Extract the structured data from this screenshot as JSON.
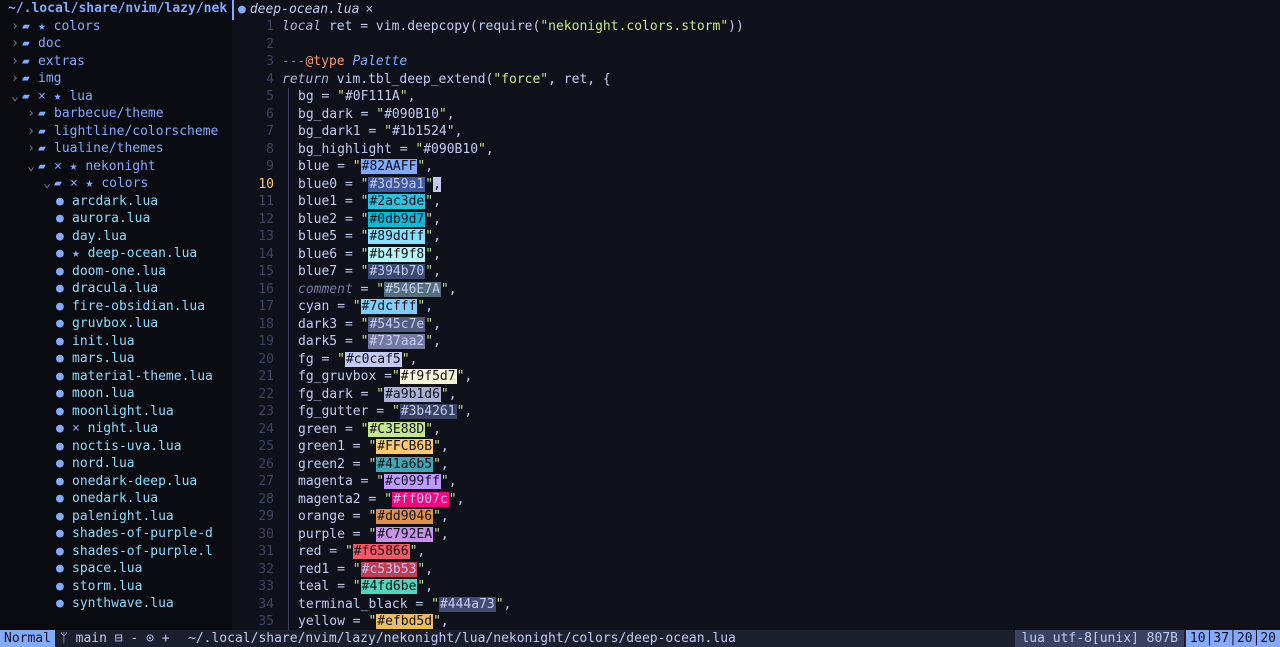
{
  "tree": {
    "root": "~/.local/share/nvim/lazy/nek",
    "rows": [
      {
        "indent": 0,
        "chev": "›",
        "type": "dir",
        "icon": "folder-icon",
        "marks": "★",
        "name": "colors"
      },
      {
        "indent": 0,
        "chev": "›",
        "type": "dir",
        "icon": "folder-icon",
        "marks": "",
        "name": "doc"
      },
      {
        "indent": 0,
        "chev": "›",
        "type": "dir",
        "icon": "folder-icon",
        "marks": "",
        "name": "extras"
      },
      {
        "indent": 0,
        "chev": "›",
        "type": "dir",
        "icon": "folder-icon",
        "marks": "",
        "name": "img"
      },
      {
        "indent": 0,
        "chev": "⌄",
        "type": "dir",
        "icon": "folder-open-icon",
        "marks": "× ★",
        "name": "lua"
      },
      {
        "indent": 1,
        "chev": "›",
        "type": "dir",
        "icon": "folder-icon",
        "marks": "",
        "name": "barbecue/theme"
      },
      {
        "indent": 1,
        "chev": "›",
        "type": "dir",
        "icon": "folder-icon",
        "marks": "",
        "name": "lightline/colorscheme"
      },
      {
        "indent": 1,
        "chev": "›",
        "type": "dir",
        "icon": "folder-icon",
        "marks": "",
        "name": "lualine/themes"
      },
      {
        "indent": 1,
        "chev": "⌄",
        "type": "dir",
        "icon": "folder-open-icon",
        "marks": "× ★",
        "name": "nekonight"
      },
      {
        "indent": 2,
        "chev": "⌄",
        "type": "dir",
        "icon": "folder-open-icon",
        "marks": "× ★",
        "name": "colors"
      },
      {
        "indent": 3,
        "chev": "",
        "type": "file",
        "icon": "lua-icon",
        "marks": "",
        "name": "arcdark.lua"
      },
      {
        "indent": 3,
        "chev": "",
        "type": "file",
        "icon": "lua-icon",
        "marks": "",
        "name": "aurora.lua"
      },
      {
        "indent": 3,
        "chev": "",
        "type": "file",
        "icon": "lua-icon",
        "marks": "",
        "name": "day.lua"
      },
      {
        "indent": 3,
        "chev": "",
        "type": "file",
        "icon": "lua-icon",
        "marks": "★",
        "name": "deep-ocean.lua"
      },
      {
        "indent": 3,
        "chev": "",
        "type": "file",
        "icon": "lua-icon",
        "marks": "",
        "name": "doom-one.lua"
      },
      {
        "indent": 3,
        "chev": "",
        "type": "file",
        "icon": "lua-icon",
        "marks": "",
        "name": "dracula.lua"
      },
      {
        "indent": 3,
        "chev": "",
        "type": "file",
        "icon": "lua-icon",
        "marks": "",
        "name": "fire-obsidian.lua"
      },
      {
        "indent": 3,
        "chev": "",
        "type": "file",
        "icon": "lua-icon",
        "marks": "",
        "name": "gruvbox.lua"
      },
      {
        "indent": 3,
        "chev": "",
        "type": "file",
        "icon": "lua-icon",
        "marks": "",
        "name": "init.lua"
      },
      {
        "indent": 3,
        "chev": "",
        "type": "file",
        "icon": "lua-icon",
        "marks": "",
        "name": "mars.lua"
      },
      {
        "indent": 3,
        "chev": "",
        "type": "file",
        "icon": "lua-icon",
        "marks": "",
        "name": "material-theme.lua"
      },
      {
        "indent": 3,
        "chev": "",
        "type": "file",
        "icon": "lua-icon",
        "marks": "",
        "name": "moon.lua"
      },
      {
        "indent": 3,
        "chev": "",
        "type": "file",
        "icon": "lua-icon",
        "marks": "",
        "name": "moonlight.lua"
      },
      {
        "indent": 3,
        "chev": "",
        "type": "file",
        "icon": "lua-icon",
        "marks": "×",
        "name": "night.lua"
      },
      {
        "indent": 3,
        "chev": "",
        "type": "file",
        "icon": "lua-icon",
        "marks": "",
        "name": "noctis-uva.lua"
      },
      {
        "indent": 3,
        "chev": "",
        "type": "file",
        "icon": "lua-icon",
        "marks": "",
        "name": "nord.lua"
      },
      {
        "indent": 3,
        "chev": "",
        "type": "file",
        "icon": "lua-icon",
        "marks": "",
        "name": "onedark-deep.lua"
      },
      {
        "indent": 3,
        "chev": "",
        "type": "file",
        "icon": "lua-icon",
        "marks": "",
        "name": "onedark.lua"
      },
      {
        "indent": 3,
        "chev": "",
        "type": "file",
        "icon": "lua-icon",
        "marks": "",
        "name": "palenight.lua"
      },
      {
        "indent": 3,
        "chev": "",
        "type": "file",
        "icon": "lua-icon",
        "marks": "",
        "name": "shades-of-purple-d"
      },
      {
        "indent": 3,
        "chev": "",
        "type": "file",
        "icon": "lua-icon",
        "marks": "",
        "name": "shades-of-purple.l"
      },
      {
        "indent": 3,
        "chev": "",
        "type": "file",
        "icon": "lua-icon",
        "marks": "",
        "name": "space.lua"
      },
      {
        "indent": 3,
        "chev": "",
        "type": "file",
        "icon": "lua-icon",
        "marks": "",
        "name": "storm.lua"
      },
      {
        "indent": 3,
        "chev": "",
        "type": "file",
        "icon": "lua-icon",
        "marks": "",
        "name": "synthwave.lua"
      }
    ]
  },
  "tab": {
    "icon": "lua-icon",
    "label": "deep-ocean.lua",
    "close": "×"
  },
  "editor": {
    "current_line": 10,
    "header_lines": [
      {
        "n": 1,
        "parts": [
          [
            "kw",
            "local"
          ],
          [
            "fn",
            " ret = vim.deepcopy("
          ],
          [
            "fn",
            "require"
          ],
          [
            "fn",
            "("
          ],
          [
            "str",
            "\"nekonight.colors.storm\""
          ],
          [
            "fn",
            "))"
          ]
        ]
      },
      {
        "n": 2,
        "parts": []
      },
      {
        "n": 3,
        "parts": [
          [
            "cmt",
            "---"
          ],
          [
            "at",
            "@type"
          ],
          [
            "ann",
            " Palette"
          ]
        ]
      },
      {
        "n": 4,
        "parts": [
          [
            "kw",
            "return"
          ],
          [
            "fn",
            " vim.tbl_deep_extend("
          ],
          [
            "str",
            "\"force\""
          ],
          [
            "fn",
            ", ret, {"
          ]
        ]
      }
    ],
    "entries": [
      {
        "n": 5,
        "key": "bg",
        "value": "#0F111A",
        "swatch": "",
        "tail": ","
      },
      {
        "n": 6,
        "key": "bg_dark",
        "value": "#090B10",
        "swatch": "",
        "tail": ","
      },
      {
        "n": 7,
        "key": "bg_dark1",
        "value": "#1b1524",
        "swatch": "",
        "tail": ","
      },
      {
        "n": 8,
        "key": "bg_highlight",
        "value": "#090B10",
        "swatch": "",
        "tail": ","
      },
      {
        "n": 9,
        "key": "blue",
        "value": "#82AAFF",
        "swatch": "#82AAFF",
        "tail": ","
      },
      {
        "n": 10,
        "key": "blue0",
        "value": "#3d59a1",
        "swatch": "#3d59a1",
        "tail": ",",
        "cursor": true
      },
      {
        "n": 11,
        "key": "blue1",
        "value": "#2ac3de",
        "swatch": "#2ac3de",
        "tail": ","
      },
      {
        "n": 12,
        "key": "blue2",
        "value": "#0db9d7",
        "swatch": "#0db9d7",
        "tail": ","
      },
      {
        "n": 13,
        "key": "blue5",
        "value": "#89ddff",
        "swatch": "#89ddff",
        "tail": ","
      },
      {
        "n": 14,
        "key": "blue6",
        "value": "#b4f9f8",
        "swatch": "#b4f9f8",
        "tail": ","
      },
      {
        "n": 15,
        "key": "blue7",
        "value": "#394b70",
        "swatch": "#394b70",
        "tail": ","
      },
      {
        "n": 16,
        "key": "comment",
        "value": "#546E7A",
        "swatch": "#546E7A",
        "tail": ",",
        "italic": true
      },
      {
        "n": 17,
        "key": "cyan",
        "value": "#7dcfff",
        "swatch": "#7dcfff",
        "tail": ","
      },
      {
        "n": 18,
        "key": "dark3",
        "value": "#545c7e",
        "swatch": "#545c7e",
        "tail": ","
      },
      {
        "n": 19,
        "key": "dark5",
        "value": "#737aa2",
        "swatch": "#737aa2",
        "tail": ","
      },
      {
        "n": 20,
        "key": "fg",
        "value": "#c0caf5",
        "swatch": "#c0caf5",
        "tail": ","
      },
      {
        "n": 21,
        "key": "fg_gruvbox",
        "value": "#f9f5d7",
        "swatch": "#f9f5d7",
        "tail": ",",
        "nospace": true
      },
      {
        "n": 22,
        "key": "fg_dark",
        "value": "#a9b1d6",
        "swatch": "#a9b1d6",
        "tail": ","
      },
      {
        "n": 23,
        "key": "fg_gutter",
        "value": "#3b4261",
        "swatch": "#3b4261",
        "tail": ","
      },
      {
        "n": 24,
        "key": "green",
        "value": "#C3E88D",
        "swatch": "#C3E88D",
        "tail": ","
      },
      {
        "n": 25,
        "key": "green1",
        "value": "#FFCB6B",
        "swatch": "#FFCB6B",
        "tail": ","
      },
      {
        "n": 26,
        "key": "green2",
        "value": "#41a6b5",
        "swatch": "#41a6b5",
        "tail": ","
      },
      {
        "n": 27,
        "key": "magenta",
        "value": "#c099ff",
        "swatch": "#c099ff",
        "tail": ","
      },
      {
        "n": 28,
        "key": "magenta2",
        "value": "#ff007c",
        "swatch": "#ff007c",
        "tail": ","
      },
      {
        "n": 29,
        "key": "orange",
        "value": "#dd9046",
        "swatch": "#dd9046",
        "tail": ","
      },
      {
        "n": 30,
        "key": "purple",
        "value": "#C792EA",
        "swatch": "#C792EA",
        "tail": ","
      },
      {
        "n": 31,
        "key": "red",
        "value": "#f65866",
        "swatch": "#f65866",
        "tail": ","
      },
      {
        "n": 32,
        "key": "red1",
        "value": "#c53b53",
        "swatch": "#c53b53",
        "tail": ","
      },
      {
        "n": 33,
        "key": "teal",
        "value": "#4fd6be",
        "swatch": "#4fd6be",
        "tail": ","
      },
      {
        "n": 34,
        "key": "terminal_black",
        "value": "#444a73",
        "swatch": "#444a73",
        "tail": ","
      },
      {
        "n": 35,
        "key": "yellow",
        "value": "#efbd5d",
        "swatch": "#efbd5d",
        "tail": ","
      }
    ]
  },
  "status": {
    "mode": "Normal",
    "branch": "ᛘ main ⊟ - ⊙ +",
    "path": "~/.local/share/nvim/lazy/nekonight/lua/nekonight/colors/deep-ocean.lua",
    "fileinfo": "lua utf-8[unix] 807B",
    "position": "10│37│20│20"
  }
}
